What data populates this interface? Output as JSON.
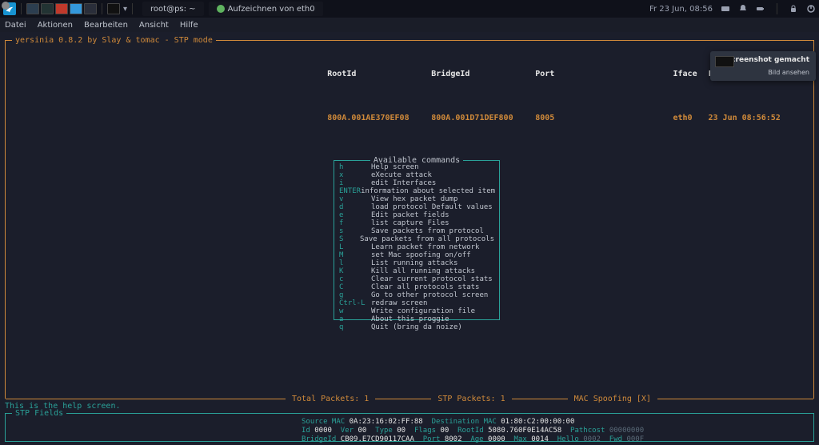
{
  "panel": {
    "tasks": [
      {
        "label": "root@ps: ~",
        "icon": "term"
      },
      {
        "label": "Aufzeichnen von eth0",
        "icon": "ws"
      }
    ],
    "clock": "Fr 23 Jun, 08:56"
  },
  "menubar": [
    "Datei",
    "Aktionen",
    "Bearbeiten",
    "Ansicht",
    "Hilfe"
  ],
  "app": {
    "title": "yersinia 0.8.2 by Slay & tomac - STP mode",
    "header": {
      "cols": [
        "RootId",
        "BridgeId",
        "Port",
        "Iface",
        "Last seen"
      ],
      "row": [
        "800A.001AE370EF08",
        "800A.001D71DEF800",
        "8005",
        "eth0",
        "23 Jun 08:56:52"
      ]
    },
    "commands": {
      "title": "Available commands",
      "items": [
        {
          "key": "h",
          "desc": "Help screen"
        },
        {
          "key": "x",
          "desc": "eXecute attack"
        },
        {
          "key": "i",
          "desc": "edit Interfaces"
        },
        {
          "key": "ENTER",
          "desc": "information about selected item"
        },
        {
          "key": "v",
          "desc": "View hex packet dump"
        },
        {
          "key": "d",
          "desc": "load protocol Default values"
        },
        {
          "key": "e",
          "desc": "Edit packet fields"
        },
        {
          "key": "f",
          "desc": "list capture Files"
        },
        {
          "key": "s",
          "desc": "Save packets from protocol"
        },
        {
          "key": "S",
          "desc": "Save packets from all protocols"
        },
        {
          "key": "L",
          "desc": "Learn packet from network"
        },
        {
          "key": "M",
          "desc": "set Mac spoofing on/off"
        },
        {
          "key": "l",
          "desc": "List running attacks"
        },
        {
          "key": "K",
          "desc": "Kill all running attacks"
        },
        {
          "key": "c",
          "desc": "Clear current protocol stats"
        },
        {
          "key": "C",
          "desc": "Clear all protocols stats"
        },
        {
          "key": "g",
          "desc": "Go to other protocol screen"
        },
        {
          "key": "Ctrl-L",
          "desc": "redraw screen"
        },
        {
          "key": "w",
          "desc": "Write configuration file"
        },
        {
          "key": "a",
          "desc": "About this proggie"
        },
        {
          "key": "q",
          "desc": "Quit (bring da noize)"
        }
      ]
    },
    "stats": {
      "total": "Total Packets: 1",
      "stp": "STP Packets: 1",
      "mac": "MAC Spoofing [X]"
    },
    "help_line": "This is the help screen. ",
    "stp_frame_title": "STP Fields",
    "stp_fields": {
      "line1": [
        {
          "lbl": "Source MAC",
          "val": "0A:23:16:02:FF:88"
        },
        {
          "lbl": "Destination MAC",
          "val": "01:80:C2:00:00:00"
        }
      ],
      "line2": [
        {
          "lbl": "Id",
          "val": "0000"
        },
        {
          "lbl": "Ver",
          "val": "00"
        },
        {
          "lbl": "Type",
          "val": "00"
        },
        {
          "lbl": "Flags",
          "val": "00"
        },
        {
          "lbl": "RootId",
          "val": "5080.760F0E14AC58"
        },
        {
          "lbl": "Pathcost",
          "val": "00000000"
        }
      ],
      "line3": [
        {
          "lbl": "BridgeId",
          "val": "CB09.E7CD90117CAA"
        },
        {
          "lbl": "Port",
          "val": "8002"
        },
        {
          "lbl": "Age",
          "val": "0000"
        },
        {
          "lbl": "Max",
          "val": "0014"
        },
        {
          "lbl": "Hello",
          "val": "0002"
        },
        {
          "lbl": "Fwd",
          "val": "000F"
        }
      ]
    }
  },
  "notification": {
    "title": "Screenshot gemacht",
    "button": "Bild ansehen"
  }
}
